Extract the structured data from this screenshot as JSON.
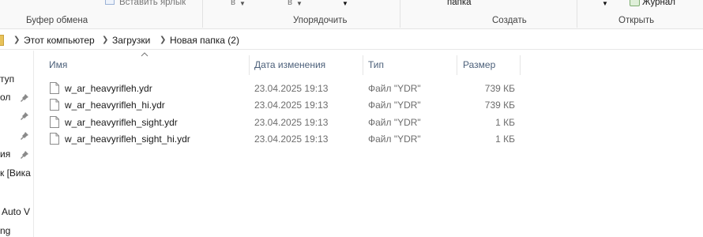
{
  "ribbon": {
    "groups": [
      "Буфер обмена",
      "Упорядочить",
      "Создать",
      "Открыть"
    ],
    "paste_shortcut_label": "Вставить ярлык",
    "move_to_fragment": "в",
    "copy_to_fragment": "в",
    "new_folder_fragment": "папка",
    "history_label": "Журнал"
  },
  "address": {
    "crumbs": [
      "Этот компьютер",
      "Загрузки",
      "Новая папка (2)"
    ]
  },
  "nav": {
    "items": [
      "туп",
      "ол",
      "",
      "ия",
      "к [Вика",
      "Auto V",
      "ng"
    ]
  },
  "columns": {
    "name": "Имя",
    "date": "Дата изменения",
    "type": "Тип",
    "size": "Размер"
  },
  "files": [
    {
      "name": "w_ar_heavyrifleh.ydr",
      "date": "23.04.2025 19:13",
      "type": "Файл \"YDR\"",
      "size": "739 КБ"
    },
    {
      "name": "w_ar_heavyrifleh_hi.ydr",
      "date": "23.04.2025 19:13",
      "type": "Файл \"YDR\"",
      "size": "739 КБ"
    },
    {
      "name": "w_ar_heavyrifleh_sight.ydr",
      "date": "23.04.2025 19:13",
      "type": "Файл \"YDR\"",
      "size": "1 КБ"
    },
    {
      "name": "w_ar_heavyrifleh_sight_hi.ydr",
      "date": "23.04.2025 19:13",
      "type": "Файл \"YDR\"",
      "size": "1 КБ"
    }
  ]
}
